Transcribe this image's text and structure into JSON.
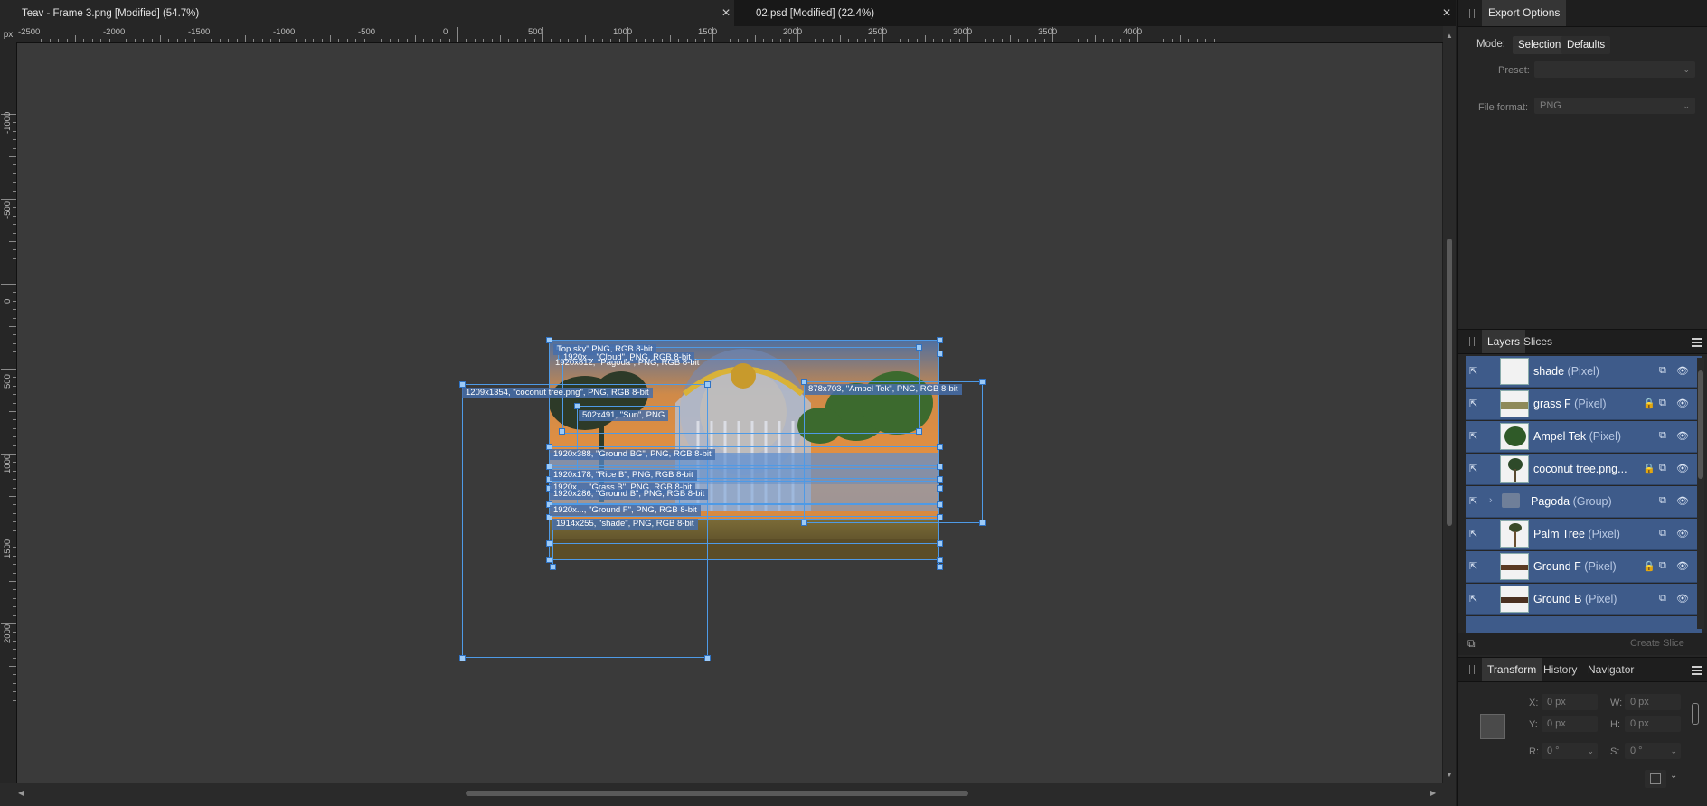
{
  "tabs": [
    {
      "label": "Teav - Frame 3.png [Modified] (54.7%)",
      "active": true
    },
    {
      "label": "02.psd [Modified] (22.4%)",
      "active": false
    }
  ],
  "tab_close_glyph": "×",
  "ruler": {
    "unit": "px",
    "top_labels": [
      "-2500",
      "-2000",
      "-1500",
      "-1000",
      "-500",
      "0",
      "500",
      "1000",
      "1500",
      "2000",
      "2500",
      "3000",
      "3500",
      "4000"
    ],
    "left_labels": [
      "-1000",
      "-500",
      "0",
      "500",
      "1000",
      "1500",
      "2000"
    ]
  },
  "slices": [
    {
      "label": "1920x1...",
      "text": "Top sky\" PNG, RGB 8-bit"
    },
    {
      "label": "sky",
      "text": "1920x... \"Cloud\", PNG, RGB 8-bit"
    },
    {
      "label": "pagoda",
      "text": "1920x812, \"Pagoda\", PNG, RGB 8-bit"
    },
    {
      "label": "coconut",
      "text": "1209x1354, \"coconut tree.png\", PNG, RGB 8-bit"
    },
    {
      "label": "ampel",
      "text": "878x703, \"Ampel Tek\", PNG, RGB 8-bit"
    },
    {
      "label": "sun",
      "text": "502x491, \"Sun\", PNG"
    },
    {
      "label": "ground-bg",
      "text": "1920x388, \"Ground BG\", PNG, RGB 8-bit"
    },
    {
      "label": "rice-b",
      "text": "1920x178, \"Rice B\", PNG, RGB 8-bit"
    },
    {
      "label": "grass-b",
      "text": "1920x..., \"Grass B\", PNG, RGB 8-bit"
    },
    {
      "label": "ground-b",
      "text": "1920x286, \"Ground B\", PNG, RGB 8-bit"
    },
    {
      "label": "ground-f",
      "text": "1920x..., \"Ground F\", PNG, RGB 8-bit"
    },
    {
      "label": "shade",
      "text": "1914x255, \"shade\", PNG, RGB 8-bit"
    }
  ],
  "export_options": {
    "title": "Export Options",
    "mode_label": "Mode:",
    "mode_selected": "Selection",
    "mode_other": "Defaults",
    "preset_label": "Preset:",
    "preset_value": "",
    "file_format_label": "File format:",
    "file_format_value": "PNG"
  },
  "layers_panel": {
    "tabs": [
      "Layers",
      "Slices"
    ],
    "items": [
      {
        "name": "shade",
        "type": "(Pixel)",
        "locked": false
      },
      {
        "name": "grass F",
        "type": "(Pixel)",
        "locked": true
      },
      {
        "name": "Ampel Tek",
        "type": "(Pixel)",
        "locked": false
      },
      {
        "name": "coconut tree.png...",
        "type": "",
        "locked": true
      },
      {
        "name": "Pagoda",
        "type": "(Group)",
        "locked": false
      },
      {
        "name": "Palm Tree",
        "type": "(Pixel)",
        "locked": false
      },
      {
        "name": "Ground F",
        "type": "(Pixel)",
        "locked": true
      },
      {
        "name": "Ground B",
        "type": "(Pixel)",
        "locked": false
      }
    ],
    "create_slice_label": "Create Slice"
  },
  "transform_panel": {
    "tabs": [
      "Transform",
      "History",
      "Navigator"
    ],
    "x_label": "X:",
    "x_value": "0 px",
    "y_label": "Y:",
    "y_value": "0 px",
    "w_label": "W:",
    "w_value": "0 px",
    "h_label": "H:",
    "h_value": "0 px",
    "r_label": "R:",
    "r_value": "0 °",
    "s_label": "S:",
    "s_value": "0 °"
  },
  "colors": {
    "selection": "#4e9ae6",
    "layer_row": "#3e5b8a",
    "canvas": "#3a3a3a"
  }
}
